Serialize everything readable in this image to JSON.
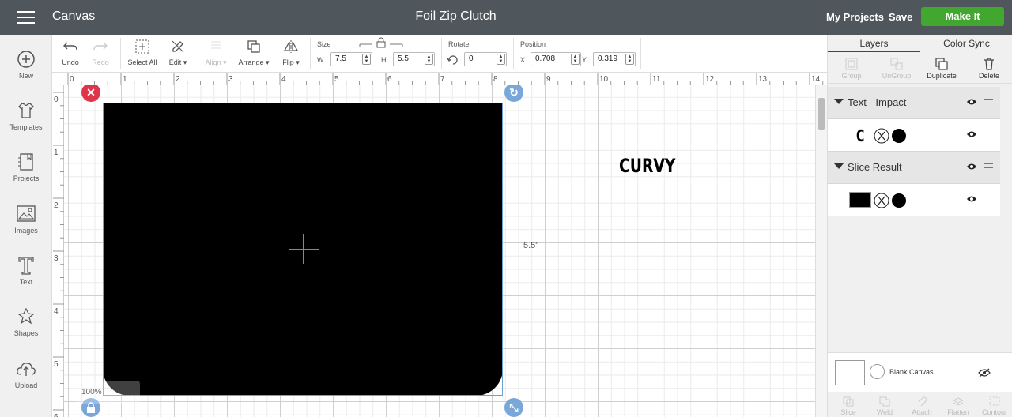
{
  "header": {
    "app_title": "Canvas",
    "document_title": "Foil Zip Clutch",
    "my_projects": "My Projects",
    "save": "Save",
    "make_it": "Make It",
    "make_it_color": "#41a72e",
    "bar_color": "#4f575c"
  },
  "left_sidebar": {
    "items": [
      {
        "label": "New",
        "icon": "plus-circle-icon"
      },
      {
        "label": "Templates",
        "icon": "shirt-icon"
      },
      {
        "label": "Projects",
        "icon": "notebook-icon"
      },
      {
        "label": "Images",
        "icon": "image-icon"
      },
      {
        "label": "Text",
        "icon": "text-T-icon"
      },
      {
        "label": "Shapes",
        "icon": "shapes-icon"
      },
      {
        "label": "Upload",
        "icon": "cloud-upload-icon"
      }
    ]
  },
  "toolbar": {
    "undo": "Undo",
    "redo": "Redo",
    "select_all": "Select All",
    "edit": "Edit",
    "align": "Align",
    "arrange": "Arrange",
    "flip": "Flip",
    "size_label": "Size",
    "w_label": "W",
    "w_value": "7.5",
    "h_label": "H",
    "h_value": "5.5",
    "rotate_label": "Rotate",
    "rotate_value": "0",
    "position_label": "Position",
    "x_label": "X",
    "x_value": "0.708",
    "y_label": "Y",
    "y_value": "0.319"
  },
  "rulers": {
    "top": [
      "0",
      "1",
      "2",
      "3",
      "4",
      "5",
      "6",
      "7",
      "8",
      "9",
      "10",
      "11",
      "12",
      "13",
      "14"
    ],
    "left": [
      "0",
      "1",
      "2",
      "3",
      "4",
      "5",
      "6"
    ]
  },
  "canvas": {
    "dimension_label": "5.5\"",
    "text_object": "CURVY",
    "zoom": "100%"
  },
  "right_panel": {
    "tabs": [
      "Layers",
      "Color Sync"
    ],
    "actions": [
      {
        "label": "Group",
        "enabled": false
      },
      {
        "label": "UnGroup",
        "enabled": false
      },
      {
        "label": "Duplicate",
        "enabled": true
      },
      {
        "label": "Delete",
        "enabled": true
      }
    ],
    "layers": [
      {
        "name": "Text - Impact",
        "child_preview": "C"
      },
      {
        "name": "Slice Result",
        "child_preview": ""
      }
    ],
    "blank_canvas": "Blank Canvas",
    "bottom_actions": [
      "Slice",
      "Weld",
      "Attach",
      "Flatten",
      "Contour"
    ]
  }
}
